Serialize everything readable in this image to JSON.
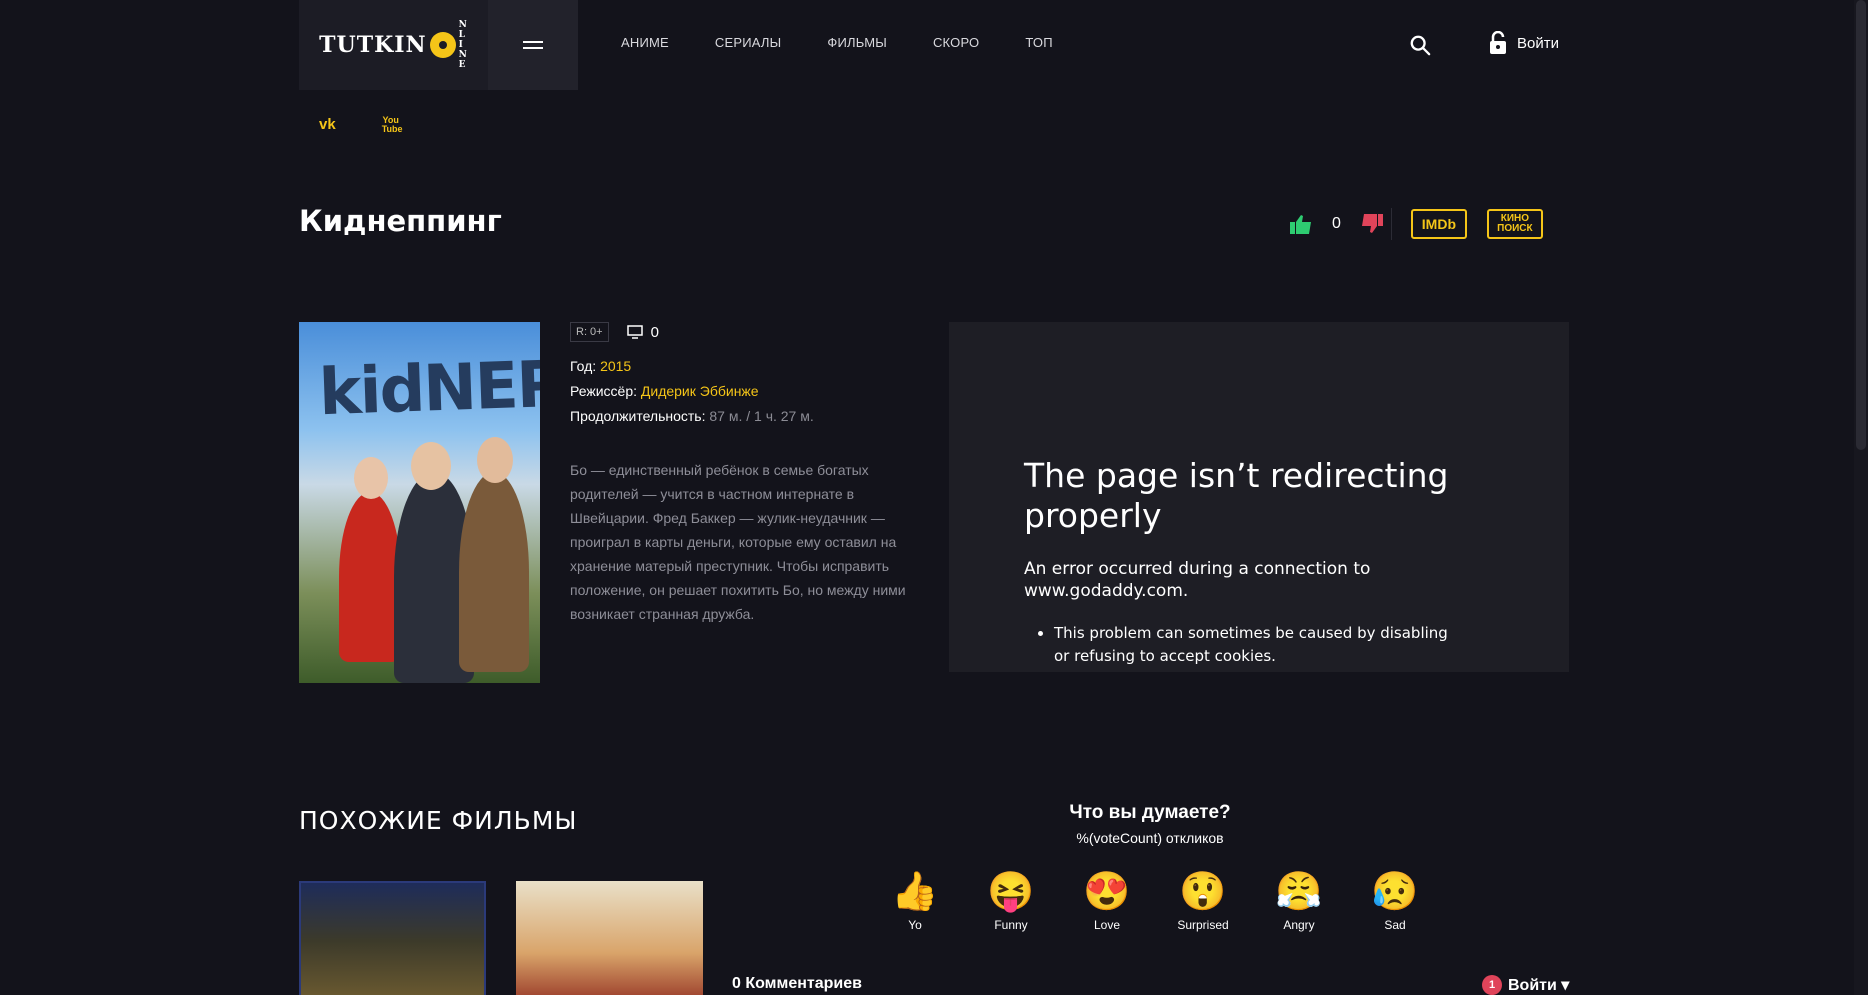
{
  "header": {
    "logo": {
      "main": "TUTKIN",
      "side": [
        "N",
        "L",
        "I",
        "N",
        "E"
      ]
    },
    "nav": [
      "АНИМЕ",
      "СЕРИАЛЫ",
      "ФИЛЬМЫ",
      "СКОРО",
      "ТОП"
    ],
    "login_label": "Войти"
  },
  "socials": {
    "vk": "vk",
    "youtube": "You Tube"
  },
  "movie": {
    "title": "Киднеппинг",
    "votes": "0",
    "imdb_label": "IMDb",
    "kp_label": "КИНО ПОИСК",
    "age": "R: 0+",
    "comments": "0",
    "year_label": "Год:",
    "year": "2015",
    "director_label": "Режиссёр:",
    "director": "Дидерик Эббинже",
    "duration_label": "Продолжительность:",
    "duration": "87 м. / 1 ч. 27 м.",
    "description": "Бо — единственный ребёнок в семье богатых родителей — учится в частном интернате в Швейцарии. Фред Баккер — жулик-неудачник — проиграл в карты деньги, которые ему оставил на хранение матерый преступник. Чтобы исправить положение, он решает похитить Бо, но между ними возникает странная дружба.",
    "poster_text": "kidNEP"
  },
  "player": {
    "error_title": "The page isn’t redirecting properly",
    "error_desc": "An error occurred during a connection to www.godaddy.com.",
    "error_item": "This problem can sometimes be caused by disabling or refusing to accept cookies."
  },
  "similar": {
    "heading": "ПОХОЖИЕ ФИЛЬМЫ"
  },
  "reactions": {
    "title": "Что вы думаете?",
    "subtitle": "%(voteCount) откликов",
    "items": [
      {
        "emoji": "👍",
        "label": "Yo"
      },
      {
        "emoji": "😝",
        "label": "Funny"
      },
      {
        "emoji": "😍",
        "label": "Love"
      },
      {
        "emoji": "😲",
        "label": "Surprised"
      },
      {
        "emoji": "😤",
        "label": "Angry"
      },
      {
        "emoji": "😥",
        "label": "Sad"
      }
    ]
  },
  "comments": {
    "count_label": "0 Комментариев",
    "login_label": "Войти ▾",
    "notif": "1"
  },
  "colors": {
    "accent": "#f5c518",
    "bg": "#13131b",
    "like": "#2ecc71",
    "dislike": "#e0445a"
  }
}
